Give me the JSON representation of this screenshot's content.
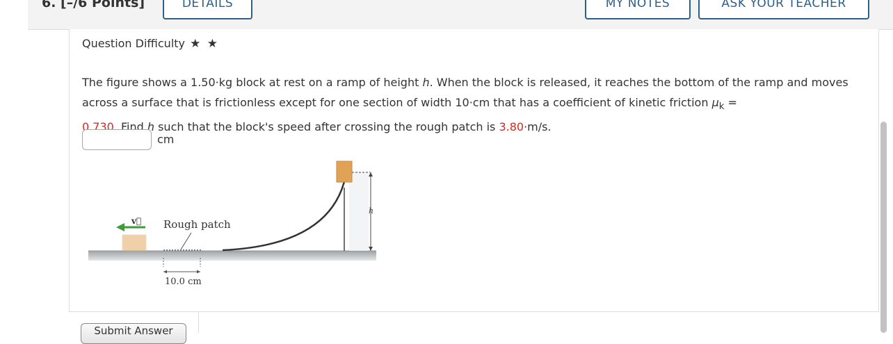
{
  "question": {
    "number_label": "6.  [–/6 Points]",
    "details_label": "DETAILS",
    "my_notes_label": "MY NOTES",
    "ask_teacher_label": "ASK YOUR TEACHER"
  },
  "difficulty": {
    "label": "Question Difficulty",
    "stars": "★ ★"
  },
  "problem": {
    "text_1": "The figure shows a 1.50·kg block at rest on a ramp of height ",
    "h": "h",
    "text_2": ". When the block is released, it reaches the bottom of the ramp and moves across a surface that is frictionless except for one section of width 10·cm that has a coefficient of kinetic friction ",
    "mu": "μ",
    "mu_sub": "k",
    "equals": " = ",
    "mu_value": "0.730",
    "text_3": ". Find ",
    "h2": "h",
    "text_4": " such that the block's speed after crossing the rough patch is ",
    "speed_value": "3.80",
    "text_5": "·m/s."
  },
  "answer": {
    "value": "",
    "unit": "cm"
  },
  "figure": {
    "velocity_label": "v⃗",
    "rough_patch_label": "Rough patch",
    "height_label": "h",
    "width_label": "10.0 cm",
    "arrow_color": "#3e9a3a",
    "block_color": "#e0a356"
  },
  "submit": {
    "label": "Submit Answer"
  }
}
